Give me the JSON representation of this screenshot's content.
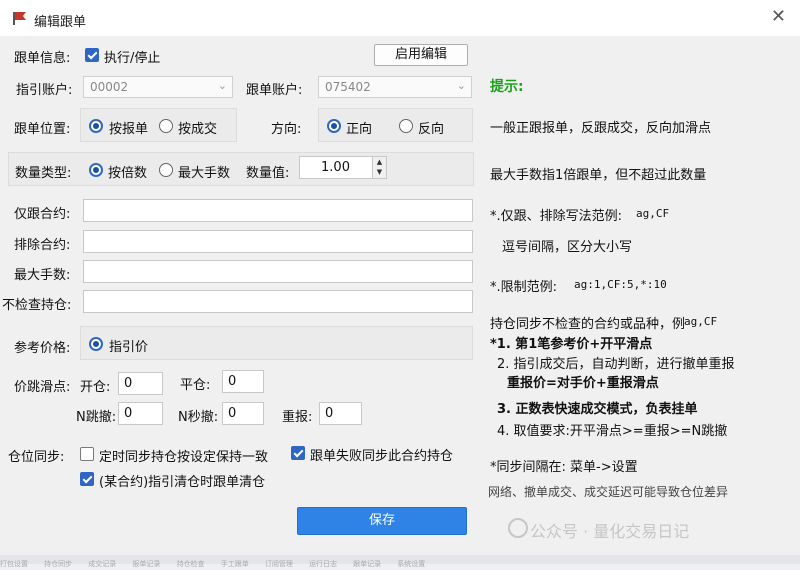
{
  "window": {
    "title": "编辑跟单",
    "close": "✕"
  },
  "info": {
    "label": "跟单信息:",
    "exec_label": "执行/停止",
    "exec_checked": true,
    "enable_edit": "启用编辑"
  },
  "accounts": {
    "guide_label": "指引账户:",
    "guide_value": "00002",
    "follow_label": "跟单账户:",
    "follow_value": "075402"
  },
  "position": {
    "label": "跟单位置:",
    "opt1": "按报单",
    "opt2": "按成交",
    "selected": "按报单"
  },
  "direction": {
    "label": "方向:",
    "opt1": "正向",
    "opt2": "反向",
    "selected": "正向"
  },
  "quantity": {
    "label": "数量类型:",
    "opt1": "按倍数",
    "opt2": "最大手数",
    "selected": "按倍数",
    "value_label": "数量值:",
    "value": "1.00"
  },
  "fields": {
    "only_contract": "仅跟合约:",
    "exclude_contract": "排除合约:",
    "max_lots": "最大手数:",
    "no_check": "不检查持仓:"
  },
  "ref_price": {
    "label": "参考价格:",
    "opt": "指引价"
  },
  "slippage": {
    "label": "价跳滑点:",
    "open_label": "开仓:",
    "open_value": "0",
    "close_label": "平仓:",
    "close_value": "0",
    "n_tick_label": "N跳撤:",
    "n_tick_value": "0",
    "n_sec_label": "N秒撤:",
    "n_sec_value": "0",
    "resend_label": "重报:",
    "resend_value": "0"
  },
  "sync": {
    "label": "仓位同步:",
    "timed_label": "定时同步持仓按设定保持一致",
    "timed_checked": false,
    "fail_label": "跟单失败同步此合约持仓",
    "fail_checked": true,
    "clear_label": "(某合约)指引清仓时跟单清仓",
    "clear_checked": true
  },
  "save_label": "保存",
  "tips": {
    "title": "提示:",
    "t1": "一般正跟报单，反跟成交，反向加滑点",
    "t2": "最大手数指1倍跟单，但不超过此数量",
    "t3a": "*.仅跟、排除写法范例:",
    "t3b": "ag,CF",
    "t4": "逗号间隔，区分大小写",
    "t5a": "*.限制范例:",
    "t5b": "ag:1,CF:5,*:10",
    "t6a": "持仓同步不检查的合约或品种，例",
    "t6b": "ag,CF",
    "t7": "*1. 第1笔参考价+开平滑点",
    "t8": "2. 指引成交后，自动判断，进行撤单重报",
    "t9": "重报价=对手价+重报滑点",
    "t10": "3. 正数表快速成交模式，负表挂单",
    "t11": "4. 取值要求:开平滑点>=重报>=N跳撤",
    "t12": "*同步间隔在: 菜单->设置",
    "t13": "网络、撤单成交、成交延迟可能导致仓位差异"
  },
  "watermark": "公众号 · 量化交易日记",
  "bottom_strip": [
    "打包设置",
    "持仓同步",
    "成交记录",
    "报单记录",
    "持仓检查",
    "手工跟单",
    "订阅管理",
    "运行日志",
    "跟单记录",
    "系统设置"
  ],
  "colors": {
    "accent": "#2f66c4",
    "save_button": "#2f83e6",
    "tip_title": "#1aa31a"
  }
}
